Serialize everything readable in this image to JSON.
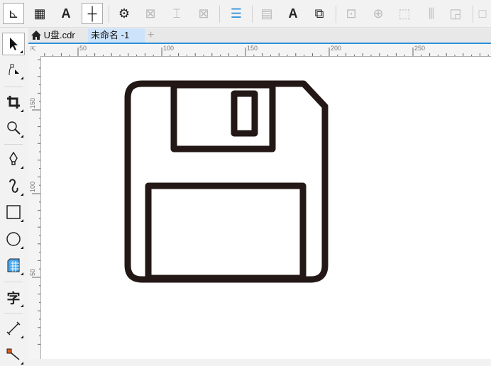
{
  "toolbar": {
    "items": [
      {
        "name": "show-rulers-icon",
        "glyph": "⊾"
      },
      {
        "name": "show-grid-icon",
        "glyph": "▦"
      },
      {
        "name": "show-text-frames-icon",
        "glyph": "A"
      },
      {
        "name": "show-guidelines-icon",
        "glyph": "┼"
      },
      {
        "name": "page-setup-icon",
        "glyph": "⚙"
      },
      {
        "name": "insert-image-placeholder-icon",
        "glyph": "⊠"
      },
      {
        "name": "text-placeholder-icon",
        "glyph": "⌶"
      },
      {
        "name": "remove-placeholder-icon",
        "glyph": "⊠"
      },
      {
        "name": "paragraph-lines-icon",
        "glyph": "☰"
      },
      {
        "name": "text-box-icon",
        "glyph": "▤"
      },
      {
        "name": "text-frame-icon",
        "glyph": "A"
      },
      {
        "name": "object-link-icon",
        "glyph": "⧉"
      },
      {
        "name": "align-icon",
        "glyph": "⊡"
      },
      {
        "name": "center-target-icon",
        "glyph": "⊕"
      },
      {
        "name": "group-bounds-icon",
        "glyph": "⬚"
      },
      {
        "name": "distribute-icon",
        "glyph": "⫼"
      },
      {
        "name": "lock-icon",
        "glyph": "◲"
      },
      {
        "name": "more-icon",
        "glyph": "□"
      }
    ]
  },
  "tabs": {
    "home_label": "",
    "file_tab": "U盘.cdr",
    "active_tab": "未命名 -1",
    "add": "+"
  },
  "ruler": {
    "unit_corner": "⇱",
    "h_labels": [
      "50",
      "100",
      "150",
      "200",
      "250"
    ],
    "v_labels": [
      "150",
      "100",
      "50"
    ]
  },
  "drawing": {
    "stroke_color": "#231815",
    "object": "floppy-disk"
  }
}
